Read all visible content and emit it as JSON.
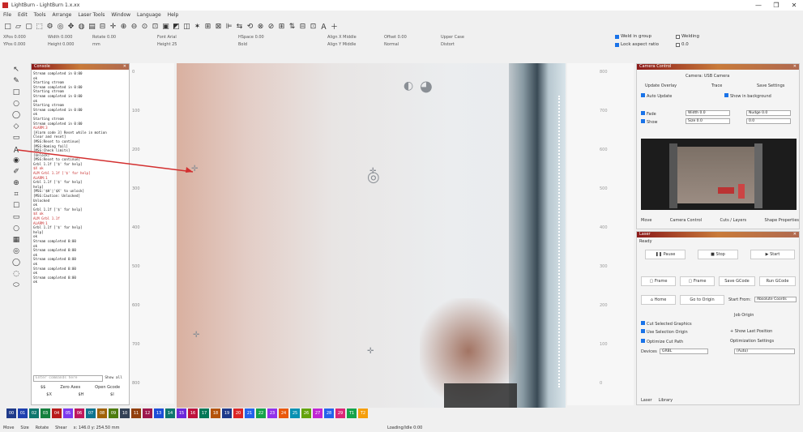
{
  "window": {
    "title": "LightBurn - LightBurn 1.x.xx",
    "controls": [
      "—",
      "❐",
      "✕"
    ]
  },
  "menu": [
    "File",
    "Edit",
    "Tools",
    "Arrange",
    "Laser Tools",
    "Window",
    "Language",
    "Help"
  ],
  "toolbar": {
    "icons": [
      "new-icon",
      "open-icon",
      "save-icon",
      "import-icon",
      "settings-icon",
      "camera-icon",
      "move-icon",
      "frame-icon",
      "print-icon",
      "delete-icon",
      "pan-icon",
      "zoom-in-icon",
      "zoom-out-icon",
      "zoom-fit-icon",
      "zoom-frame-icon",
      "camera-capture-icon",
      "trace-icon",
      "nudge-icon",
      "magic-icon",
      "group-icon",
      "ungroup-icon",
      "align-icon",
      "mirror-icon",
      "rotate-icon",
      "weld-icon",
      "break-icon",
      "grid-icon",
      "flip-icon",
      "array-icon",
      "offset-icon",
      "text-icon",
      "plus-icon"
    ],
    "glyphs": [
      "□",
      "▱",
      "▢",
      "⬚",
      "⚙",
      "◎",
      "✥",
      "◍",
      "▤",
      "⊟",
      "✛",
      "⊕",
      "⊖",
      "⊙",
      "⊡",
      "▣",
      "◩",
      "◫",
      "✶",
      "⊞",
      "⊠",
      "⊫",
      "⇆",
      "⟲",
      "⊗",
      "⊘",
      "⊞",
      "⇅",
      "⊟",
      "⊡",
      "Ａ",
      "＋"
    ]
  },
  "toolbar2": {
    "groups": [
      [
        "XPos 0.000",
        "YPos 0.000"
      ],
      [
        "Width 0.000",
        "Height 0.000"
      ],
      [
        "Rotate 0.00",
        "mm"
      ],
      [
        "Font Arial",
        "Height 25"
      ],
      [
        "HSpace 0.00",
        "Bold"
      ],
      [
        "Align X Middle",
        "Align Y Middle"
      ],
      [
        "Offset 0.00",
        "Normal"
      ],
      [
        "Upper Case",
        "Distort"
      ]
    ],
    "checks": [
      {
        "label": "Weld in group",
        "on": true
      },
      {
        "label": "Lock aspect ratio",
        "on": true
      },
      {
        "label": "Welding",
        "on": false
      },
      {
        "label": "0.0",
        "on": false
      }
    ]
  },
  "tools": [
    "↖",
    "✎",
    "□",
    "○",
    "◯",
    "◇",
    "▭",
    "Ａ",
    "◉",
    "✐",
    "⊕",
    "⌗",
    "☐",
    "▭",
    "○",
    "▦",
    "◎",
    "◯",
    "◌",
    "⬭"
  ],
  "console": {
    "title": "Console",
    "lines": [
      {
        "t": "Stream completed in 0:00",
        "red": false
      },
      {
        "t": "ok",
        "red": false
      },
      {
        "t": "Starting stream",
        "red": false
      },
      {
        "t": "Stream completed in 0:00",
        "red": false
      },
      {
        "t": "Starting stream",
        "red": false
      },
      {
        "t": "Stream completed in 0:00",
        "red": false
      },
      {
        "t": "ok",
        "red": false
      },
      {
        "t": "Starting stream",
        "red": false
      },
      {
        "t": "Stream completed in 0:00",
        "red": false
      },
      {
        "t": "ok",
        "red": false
      },
      {
        "t": "Starting stream",
        "red": false
      },
      {
        "t": "Stream completed in 0:00",
        "red": false
      },
      {
        "t": "ALARM:3",
        "red": true
      },
      {
        "t": "[Alarm code 3] Reset while in motion",
        "red": false
      },
      {
        "t": "Clear and reset]",
        "red": false
      },
      {
        "t": "[MSG:Reset to continue]",
        "red": false
      },
      {
        "t": "[MSG:Homing fail]",
        "red": false
      },
      {
        "t": "[MSG:Check limits]",
        "red": false
      },
      {
        "t": "[Unlock]",
        "red": false
      },
      {
        "t": "[MSG:Reset to continue]",
        "red": false
      },
      {
        "t": "Grbl 1.1f ['$' for help]",
        "red": false
      },
      {
        "t": "$X ok",
        "red": true
      },
      {
        "t": "ALM Grbl 1.1f ['$' for help]",
        "red": true
      },
      {
        "t": "ALARM:1",
        "red": true
      },
      {
        "t": "Grbl 1.1f ['$' for help]",
        "red": false
      },
      {
        "t": "help]",
        "red": false
      },
      {
        "t": "[MSG:'$H'|'$X' to unlock]",
        "red": false
      },
      {
        "t": "[MSG:Caution: Unlocked]",
        "red": false
      },
      {
        "t": "Unlocked",
        "red": false
      },
      {
        "t": "ok",
        "red": false
      },
      {
        "t": "Grbl 1.1f ['$' for help]",
        "red": false
      },
      {
        "t": "$X ok",
        "red": true
      },
      {
        "t": "ALM Grbl 1.1f",
        "red": true
      },
      {
        "t": "ALARM:1",
        "red": true
      },
      {
        "t": "Grbl 1.1f ['$' for help]",
        "red": false
      },
      {
        "t": "help]",
        "red": false
      },
      {
        "t": "ok",
        "red": false
      },
      {
        "t": "Stream completed 0:00",
        "red": false
      },
      {
        "t": "ok",
        "red": false
      },
      {
        "t": "Stream completed 0:00",
        "red": false
      },
      {
        "t": "ok",
        "red": false
      },
      {
        "t": "Stream completed 0:00",
        "red": false
      },
      {
        "t": "ok",
        "red": false
      },
      {
        "t": "Stream completed 0:00",
        "red": false
      },
      {
        "t": "ok",
        "red": false
      },
      {
        "t": "Stream completed 0:00",
        "red": false
      },
      {
        "t": "ok",
        "red": false
      }
    ],
    "input_placeholder": "Enter commands here",
    "show_all_label": "Show all",
    "buttons_row1": [
      "$$",
      "Zero Axes",
      "Open Gcode"
    ],
    "buttons_row2": [
      "$X",
      "$H",
      "$I"
    ]
  },
  "ruler_left": [
    "0",
    "100",
    "200",
    "300",
    "400",
    "500",
    "600",
    "700",
    "800"
  ],
  "ruler_right": [
    "800",
    "700",
    "600",
    "500",
    "400",
    "300",
    "200",
    "100",
    "0"
  ],
  "camera": {
    "title": "Camera Control",
    "device_label": "Camera: USB Camera",
    "update_overlay": "Update Overlay",
    "trace": "Trace",
    "save_settings": "Save Settings",
    "auto_update": "Auto Update",
    "show_in_background": "Show in background",
    "fade": "Fade",
    "show": "Show",
    "fade_val": "Width 0.0",
    "show_val": "0.0",
    "nudge": "Nudge 0.0",
    "size_label": "Size 0.0",
    "tabs": [
      "Move",
      "Camera Control",
      "Cuts / Layers",
      "Shape Properties"
    ]
  },
  "laser": {
    "title": "Laser",
    "status": "Ready",
    "pause": "Pause",
    "stop": "Stop",
    "start": "Start",
    "frame": "Frame",
    "frame2": "Frame",
    "save_gcode": "Save GCode",
    "run_gcode": "Run GCode",
    "home": "Home",
    "go_to_origin": "Go to Origin",
    "start_from": "Start From:",
    "start_from_val": "Absolute Coords",
    "job_origin": "Job Origin",
    "cut_selected": "Cut Selected Graphics",
    "use_selection_origin": "Use Selection Origin",
    "optimize_cut_path": "Optimize Cut Path",
    "show_last_position": "+ Show Last Position",
    "optimization_settings": "Optimization Settings",
    "devices": "Devices",
    "device_val": "GRBL",
    "port": "(Auto)",
    "bottom_tabs": [
      "Laser",
      "Library"
    ]
  },
  "palette": [
    "#1e3a8a",
    "#1e40af",
    "#0f766e",
    "#15803d",
    "#b91c1c",
    "#7c3aed",
    "#be185d",
    "#0e7490",
    "#a16207",
    "#4d7c0f",
    "#334155",
    "#92400e",
    "#9d174d",
    "#1d4ed8",
    "#0f766e",
    "#6d28d9",
    "#be123c",
    "#047857",
    "#b45309",
    "#1e3a8a",
    "#dc2626",
    "#2563eb",
    "#16a34a",
    "#9333ea",
    "#ea580c",
    "#0891b2",
    "#65a30d",
    "#c026d3",
    "#2563eb",
    "#db2777",
    "#16a34a",
    "#f59e0b"
  ],
  "palette_labels": [
    "00",
    "01",
    "02",
    "03",
    "04",
    "05",
    "06",
    "07",
    "08",
    "09",
    "10",
    "11",
    "12",
    "13",
    "14",
    "15",
    "16",
    "17",
    "18",
    "19",
    "20",
    "21",
    "22",
    "23",
    "24",
    "25",
    "26",
    "27",
    "28",
    "29",
    "T1",
    "T2"
  ],
  "status": {
    "items": [
      "Move",
      "Size",
      "Rotate",
      "Shear"
    ],
    "coords": "x: 146.0 y: 254.50 mm",
    "center": "Loading/Idle 0:00"
  }
}
